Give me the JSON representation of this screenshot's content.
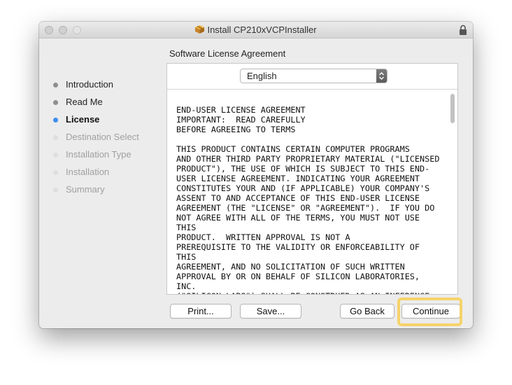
{
  "window": {
    "title": "Install CP210xVCPInstaller"
  },
  "icons": {
    "package": "package-icon",
    "lock": "lock-icon",
    "stepper": "up-down-stepper-icon"
  },
  "heading": "Software License Agreement",
  "steps": [
    {
      "label": "Introduction",
      "state": "done"
    },
    {
      "label": "Read Me",
      "state": "done"
    },
    {
      "label": "License",
      "state": "current"
    },
    {
      "label": "Destination Select",
      "state": "pending"
    },
    {
      "label": "Installation Type",
      "state": "pending"
    },
    {
      "label": "Installation",
      "state": "pending"
    },
    {
      "label": "Summary",
      "state": "pending"
    }
  ],
  "language": {
    "selected": "English"
  },
  "license_text": "END-USER LICENSE AGREEMENT\nIMPORTANT:  READ CAREFULLY\nBEFORE AGREEING TO TERMS\n\nTHIS PRODUCT CONTAINS CERTAIN COMPUTER PROGRAMS\nAND OTHER THIRD PARTY PROPRIETARY MATERIAL (\"LICENSED\nPRODUCT\"), THE USE OF WHICH IS SUBJECT TO THIS END-\nUSER LICENSE AGREEMENT. INDICATING YOUR AGREEMENT\nCONSTITUTES YOUR AND (IF APPLICABLE) YOUR COMPANY'S\nASSENT TO AND ACCEPTANCE OF THIS END-USER LICENSE\nAGREEMENT (THE \"LICENSE\" OR \"AGREEMENT\").  IF YOU DO\nNOT AGREE WITH ALL OF THE TERMS, YOU MUST NOT USE THIS\nPRODUCT.  WRITTEN APPROVAL IS NOT A\nPREREQUISITE TO THE VALIDITY OR ENFORCEABILITY OF THIS\nAGREEMENT, AND NO SOLICITATION OF SUCH WRITTEN\nAPPROVAL BY OR ON BEHALF OF SILICON LABORATORIES, INC.\n(\"SILICON LABS\") SHALL BE CONSTRUED AS AN INFERENCE TO\nTHE CONTRARY.  IF THESE TERMS ARE CONSIDERED AN OFFER\nBY SILICON LABS, ACCEPTANCE IS EXPRESSLY LIMITED TO\nTHESE TERMS.",
  "buttons": {
    "print": "Print...",
    "save": "Save...",
    "go_back": "Go Back",
    "continue": "Continue"
  },
  "colors": {
    "current_step": "#3f8ef0",
    "highlight": "#f6d36a"
  }
}
